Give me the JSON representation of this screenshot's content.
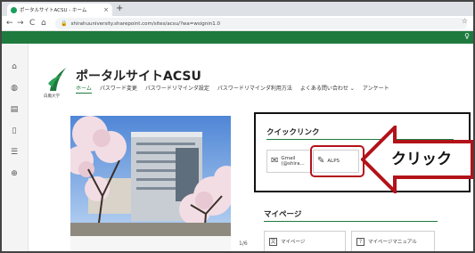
{
  "browser": {
    "tab_title": "ポータルサイトACSU - ホーム",
    "tab_close": "×",
    "new_tab": "+",
    "back": "←",
    "forward": "→",
    "reload": "C",
    "home": "⌂",
    "url": "shirahuuniversity.sharepoint.com/sites/acsu/?wa=wsignin1.0"
  },
  "site": {
    "logo_caption": "白鳳大学",
    "title": "ポータルサイトACSU",
    "nav": [
      "ホーム",
      "パスワード変更",
      "パスワードリマインダ設定",
      "パスワードリマインダ利用方法",
      "よくある問い合わせ ⌄",
      "アンケート"
    ]
  },
  "hero": {
    "counter": "1/6"
  },
  "quick_links": {
    "title": "クイックリンク",
    "tiles": [
      {
        "icon": "mail-icon",
        "text_line1": "Gmail",
        "text_line2": "(@shira..."
      },
      {
        "icon": "pencil-icon",
        "text_line1": "ALPS"
      }
    ]
  },
  "callout": {
    "label": "クリック",
    "color": "#b3121a"
  },
  "my_page": {
    "title": "マイページ",
    "tiles": [
      {
        "icon_glyph": "文",
        "label": "マイページ"
      },
      {
        "icon_glyph": "?",
        "label": "マイページマニュアル"
      }
    ]
  },
  "colors": {
    "brand_green": "#1f7a3e",
    "highlight_red": "#b3121a"
  }
}
